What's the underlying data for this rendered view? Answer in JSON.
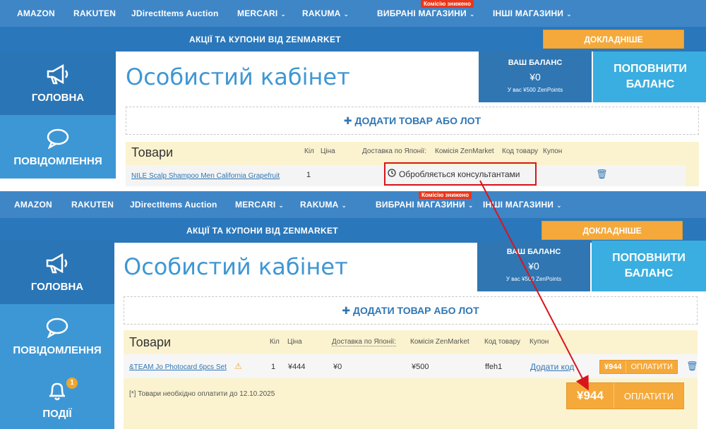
{
  "nav": {
    "items": [
      "AMAZON",
      "RAKUTEN",
      "JDirectItems Auction",
      "MERCARI",
      "RAKUMA",
      "ВИБРАНІ МАГАЗИНИ",
      "ІНШІ МАГАЗИНИ"
    ],
    "commission_badge": "Комісію знижено"
  },
  "promo": {
    "text": "АКЦІЇ ТА КУПОНИ ВІД ZENMARKET",
    "button": "ДОКЛАДНІШЕ"
  },
  "sidebar": {
    "home": "ГОЛОВНА",
    "messages": "ПОВІДОМЛЕННЯ",
    "events": "ПОДІЇ",
    "events_count": "1"
  },
  "page": {
    "title": "Особистий кабінет"
  },
  "balance": {
    "label": "ВАШ БАЛАНС",
    "value": "¥0",
    "points": "У вас ¥500 ZenPoints",
    "topup": "ПОПОВНИТИ БАЛАНС"
  },
  "add_item": "ДОДАТИ ТОВАР АБО ЛОТ",
  "goods": {
    "title": "Товари",
    "columns_top": {
      "qty": "Кіл",
      "price": "Ціна",
      "shipping": "Доставка по Японії:",
      "commission": "Комісія ZenMarket",
      "code": "Код товару",
      "coupon": "Купон"
    },
    "columns_bottom": {
      "qty": "Кіл",
      "price": "Ціна",
      "shipping": "Доставка по Японії:",
      "commission": "Комісія ZenMarket",
      "code": "Код товару",
      "coupon": "Купон"
    },
    "row_top": {
      "name": "NILE Scalp Shampoo Men California Grapefruit",
      "qty": "1",
      "status": "Обробляється консультантами"
    },
    "row_bottom": {
      "name": "&TEAM Jo Photocard 6pcs Set",
      "qty": "1",
      "price": "¥444",
      "shipping": "¥0",
      "commission": "¥500",
      "code": "ffeh1",
      "coupon_link": "Додати код",
      "pay_amount": "¥944",
      "pay_label": "ОПЛАТИТИ"
    },
    "deadline": "[*] Товари необхідно оплатити до 12.10.2025",
    "total_amount": "¥944",
    "total_pay": "ОПЛАТИТИ"
  },
  "colors": {
    "nav": "#3f86c7",
    "promo": "#2a77bb",
    "accent_orange": "#f5a93a",
    "annotation_red": "#d8151d"
  }
}
